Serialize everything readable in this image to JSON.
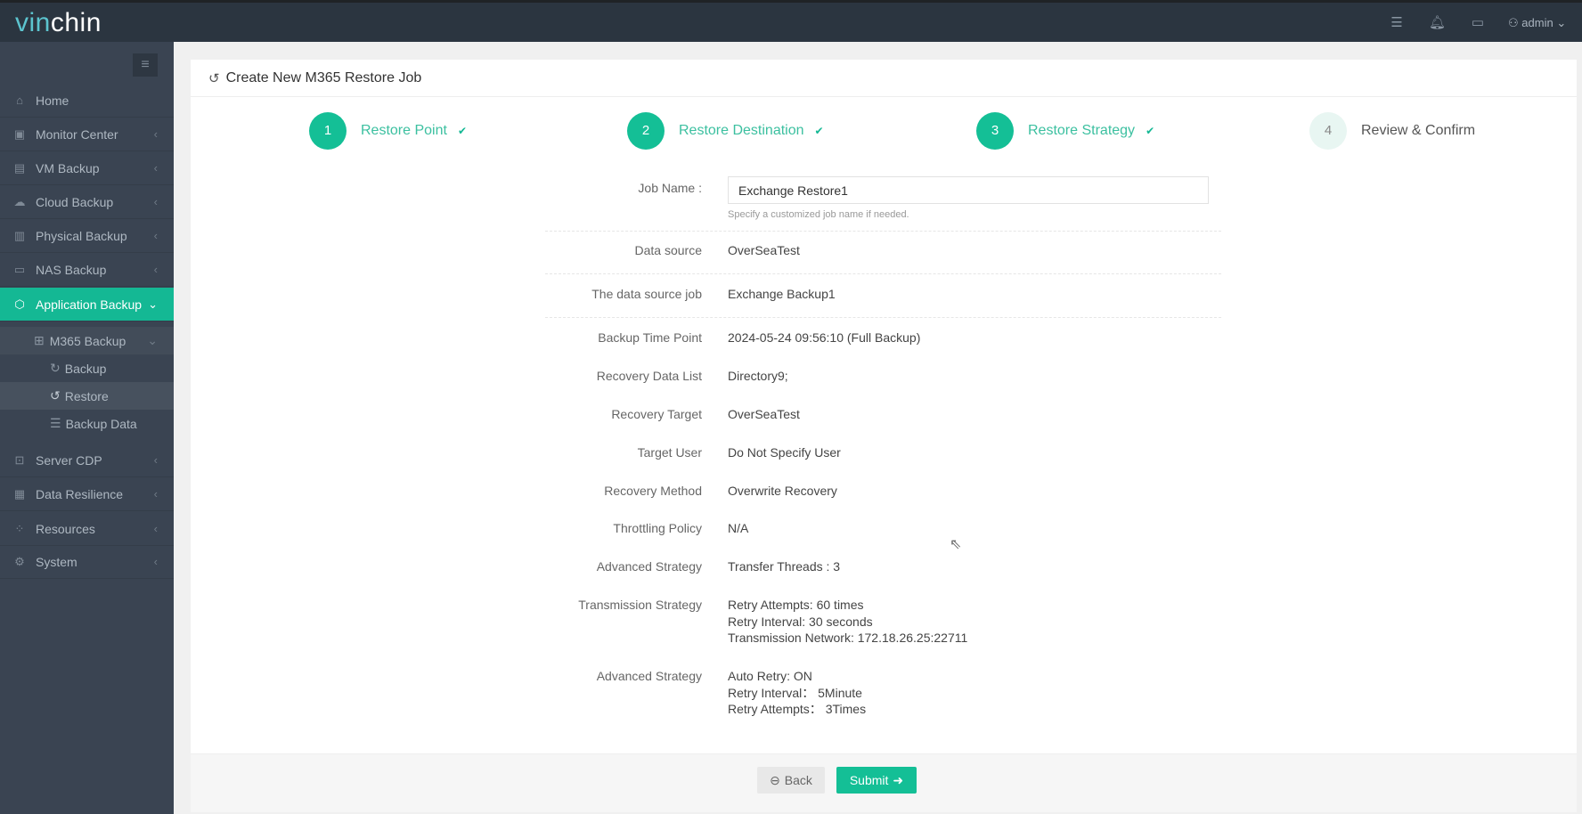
{
  "header": {
    "logo_a": "vin",
    "logo_b": "chin",
    "user": "admin"
  },
  "sidebar": {
    "items": [
      {
        "label": "Home",
        "icon": "home-icon"
      },
      {
        "label": "Monitor Center",
        "icon": "monitor-icon"
      },
      {
        "label": "VM Backup",
        "icon": "vm-icon"
      },
      {
        "label": "Cloud Backup",
        "icon": "cloud-icon"
      },
      {
        "label": "Physical Backup",
        "icon": "server-icon"
      },
      {
        "label": "NAS Backup",
        "icon": "nas-icon"
      },
      {
        "label": "Application Backup",
        "icon": "app-icon"
      },
      {
        "label": "Server CDP",
        "icon": "cdp-icon"
      },
      {
        "label": "Data Resilience",
        "icon": "resilience-icon"
      },
      {
        "label": "Resources",
        "icon": "resources-icon"
      },
      {
        "label": "System",
        "icon": "gear-icon"
      }
    ],
    "m365": "M365 Backup",
    "sub": [
      "Backup",
      "Restore",
      "Backup Data"
    ]
  },
  "page": {
    "title": "Create New M365 Restore Job"
  },
  "steps": [
    {
      "num": "1",
      "label": "Restore Point"
    },
    {
      "num": "2",
      "label": "Restore Destination"
    },
    {
      "num": "3",
      "label": "Restore Strategy"
    },
    {
      "num": "4",
      "label": "Review & Confirm"
    }
  ],
  "form": {
    "job_name_label": "Job Name :",
    "job_name_value": "Exchange Restore1",
    "job_name_help": "Specify a customized job name if needed.",
    "rows": [
      {
        "label": "Data source",
        "value": "OverSeaTest"
      },
      {
        "label": "The data source job",
        "value": "Exchange Backup1"
      },
      {
        "label": "Backup Time Point",
        "value": "2024-05-24 09:56:10 (Full Backup)"
      },
      {
        "label": "Recovery Data List",
        "value": "Directory9;"
      },
      {
        "label": "Recovery Target",
        "value": "OverSeaTest"
      },
      {
        "label": "Target User",
        "value": "Do Not Specify User"
      },
      {
        "label": "Recovery Method",
        "value": "Overwrite Recovery"
      },
      {
        "label": "Throttling Policy",
        "value": "N/A"
      },
      {
        "label": "Advanced Strategy",
        "value": "Transfer Threads : 3"
      }
    ],
    "transmission": {
      "label": "Transmission Strategy",
      "lines": [
        "Retry Attempts: 60 times",
        "Retry Interval: 30 seconds",
        "Transmission Network: 172.18.26.25:22711"
      ]
    },
    "advanced2": {
      "label": "Advanced Strategy",
      "lines": [
        "Auto Retry:  ON",
        "Retry Interval：  5Minute",
        "Retry Attempts：  3Times"
      ]
    }
  },
  "footer": {
    "back": "Back",
    "submit": "Submit"
  },
  "colors": {
    "accent": "#14bf96",
    "header": "#2b3540",
    "sidebar": "#3a4452"
  }
}
